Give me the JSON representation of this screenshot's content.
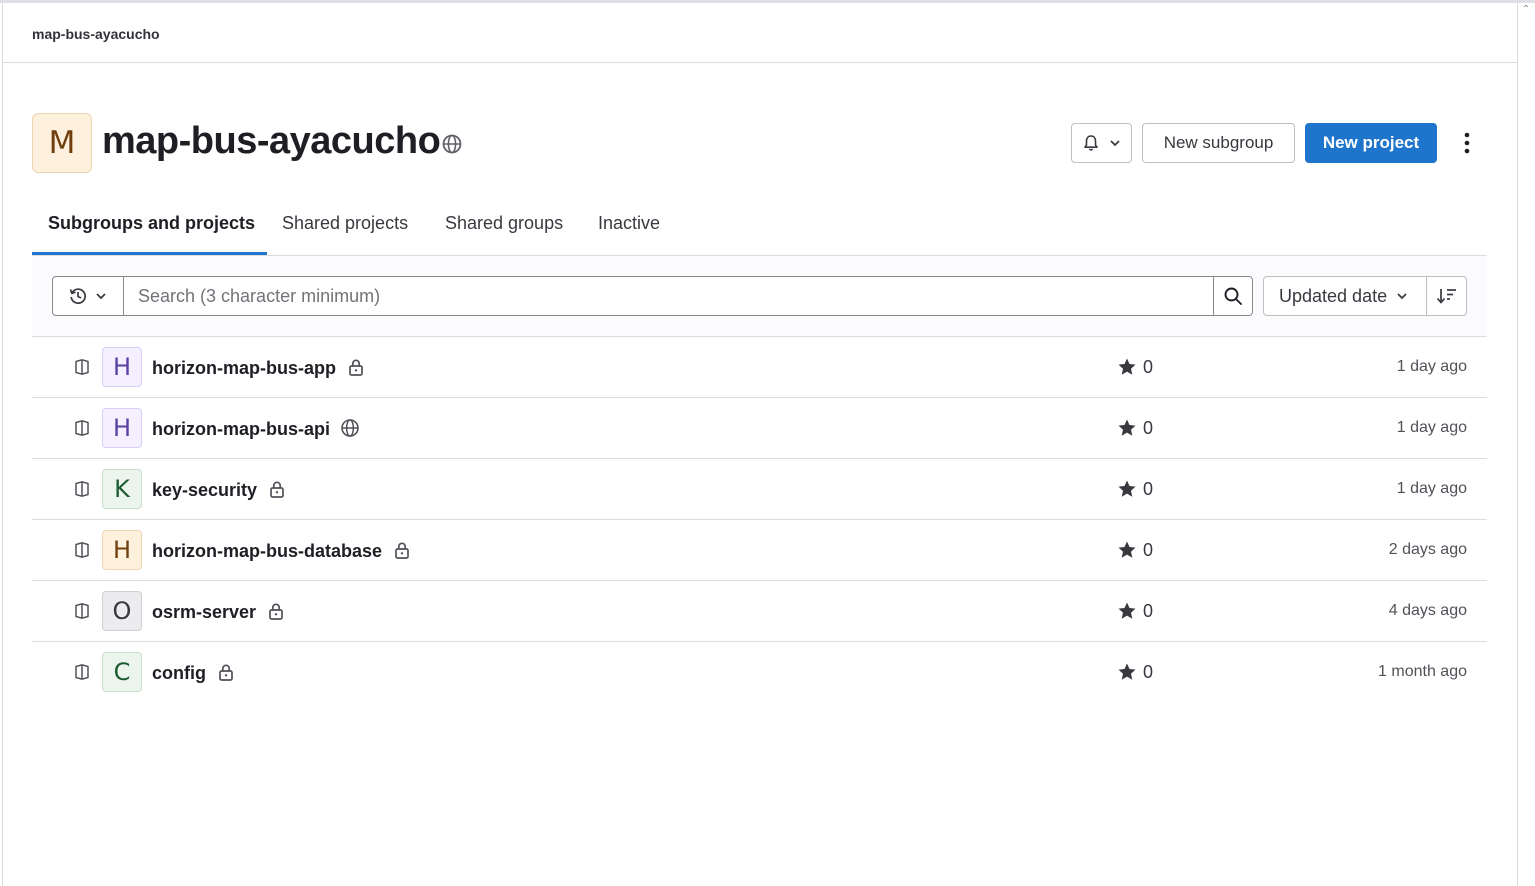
{
  "breadcrumb": "map-bus-ayacucho",
  "group": {
    "avatar_letter": "M",
    "title": "map-bus-ayacucho",
    "visibility_icon": "globe-icon"
  },
  "actions": {
    "notifications_icon": "bell-icon",
    "new_subgroup": "New subgroup",
    "new_project": "New project",
    "more_icon": "kebab-icon"
  },
  "tabs": [
    {
      "label": "Subgroups and projects",
      "active": true
    },
    {
      "label": "Shared projects",
      "active": false
    },
    {
      "label": "Shared groups",
      "active": false
    },
    {
      "label": "Inactive",
      "active": false
    }
  ],
  "filter": {
    "history_icon": "history-icon",
    "search_placeholder": "Search (3 character minimum)",
    "search_value": "",
    "sort_label": "Updated date",
    "sort_direction_icon": "sort-lowest-icon"
  },
  "colors": {
    "accent": "#1f75cb",
    "border": "#dcdcde"
  },
  "projects": [
    {
      "letter": "H",
      "avatar_color": "purple",
      "name": "horizon-map-bus-app",
      "visibility": "lock-icon",
      "stars": "0",
      "updated": "1 day ago"
    },
    {
      "letter": "H",
      "avatar_color": "purple",
      "name": "horizon-map-bus-api",
      "visibility": "globe-icon",
      "stars": "0",
      "updated": "1 day ago"
    },
    {
      "letter": "K",
      "avatar_color": "green",
      "name": "key-security",
      "visibility": "lock-icon",
      "stars": "0",
      "updated": "1 day ago"
    },
    {
      "letter": "H",
      "avatar_color": "orange",
      "name": "horizon-map-bus-database",
      "visibility": "lock-icon",
      "stars": "0",
      "updated": "2 days ago"
    },
    {
      "letter": "O",
      "avatar_color": "gray",
      "name": "osrm-server",
      "visibility": "lock-icon",
      "stars": "0",
      "updated": "4 days ago"
    },
    {
      "letter": "C",
      "avatar_color": "green",
      "name": "config",
      "visibility": "lock-icon",
      "stars": "0",
      "updated": "1 month ago"
    }
  ]
}
